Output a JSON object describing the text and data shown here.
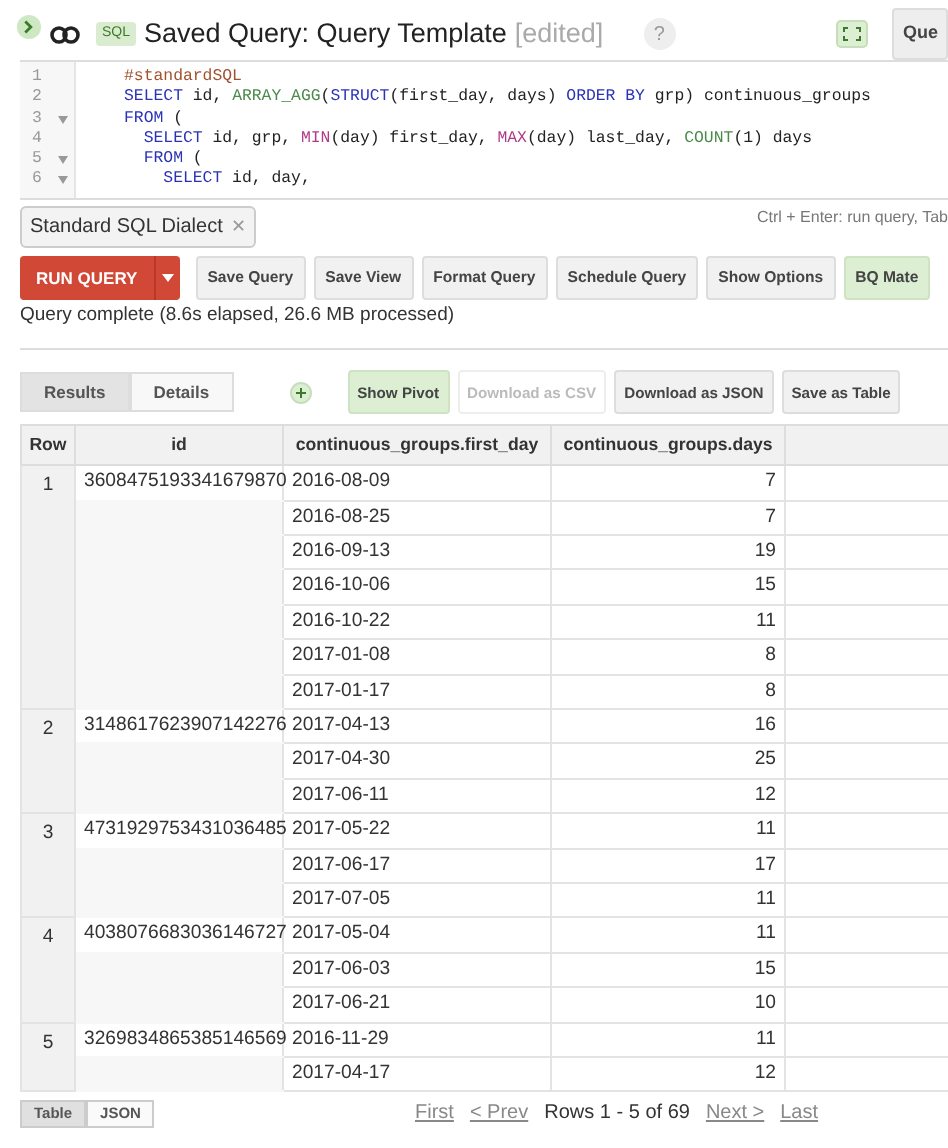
{
  "header": {
    "tag": "SQL",
    "title": "Saved Query: Query Template",
    "state": "[edited]",
    "help": "?",
    "cut_button": "Que"
  },
  "editor": {
    "lines": [
      {
        "number": "1",
        "fold": false,
        "tokens": [
          {
            "kind": "comment",
            "text": "#standardSQL"
          }
        ]
      },
      {
        "number": "2",
        "fold": false,
        "tokens": [
          {
            "kind": "keyword",
            "text": "SELECT"
          },
          {
            "kind": "plain",
            "text": " id, "
          },
          {
            "kind": "function",
            "text": "ARRAY_AGG"
          },
          {
            "kind": "plain",
            "text": "("
          },
          {
            "kind": "keyword",
            "text": "STRUCT"
          },
          {
            "kind": "plain",
            "text": "(first_day, days) "
          },
          {
            "kind": "keyword",
            "text": "ORDER BY"
          },
          {
            "kind": "plain",
            "text": " grp) continuous_groups"
          }
        ]
      },
      {
        "number": "3",
        "fold": true,
        "tokens": [
          {
            "kind": "keyword",
            "text": "FROM"
          },
          {
            "kind": "plain",
            "text": " ("
          }
        ]
      },
      {
        "number": "4",
        "fold": false,
        "tokens": [
          {
            "kind": "keyword",
            "text": "  SELECT"
          },
          {
            "kind": "plain",
            "text": " id, grp, "
          },
          {
            "kind": "builtin",
            "text": "MIN"
          },
          {
            "kind": "plain",
            "text": "(day) first_day, "
          },
          {
            "kind": "builtin",
            "text": "MAX"
          },
          {
            "kind": "plain",
            "text": "(day) last_day, "
          },
          {
            "kind": "function",
            "text": "COUNT"
          },
          {
            "kind": "plain",
            "text": "(1) days"
          }
        ]
      },
      {
        "number": "5",
        "fold": true,
        "tokens": [
          {
            "kind": "keyword",
            "text": "  FROM"
          },
          {
            "kind": "plain",
            "text": " ("
          }
        ]
      },
      {
        "number": "6",
        "fold": true,
        "tokens": [
          {
            "kind": "keyword",
            "text": "    SELECT"
          },
          {
            "kind": "plain",
            "text": " id, day,"
          }
        ]
      }
    ],
    "hint": "Ctrl + Enter: run query, Tab"
  },
  "dialect_chip": {
    "label": "Standard SQL Dialect",
    "close": "✕"
  },
  "toolbar": {
    "run": "RUN QUERY",
    "buttons": [
      {
        "label": "Save Query",
        "kind": "plain"
      },
      {
        "label": "Save View",
        "kind": "plain"
      },
      {
        "label": "Format Query",
        "kind": "plain"
      },
      {
        "label": "Schedule Query",
        "kind": "plain"
      },
      {
        "label": "Show Options",
        "kind": "plain"
      },
      {
        "label": "BQ Mate",
        "kind": "green"
      }
    ]
  },
  "status": "Query complete (8.6s elapsed, 26.6 MB processed)",
  "result_tabs": [
    {
      "label": "Results",
      "selected": true
    },
    {
      "label": "Details",
      "selected": false
    }
  ],
  "result_buttons": [
    {
      "label": "Show Pivot",
      "kind": "green"
    },
    {
      "label": "Download as CSV",
      "kind": "disabled"
    },
    {
      "label": "Download as JSON",
      "kind": "plain"
    },
    {
      "label": "Save as Table",
      "kind": "plain"
    }
  ],
  "table": {
    "columns": [
      "Row",
      "id",
      "continuous_groups.first_day",
      "continuous_groups.days"
    ],
    "rows": [
      {
        "row": "1",
        "id": "3608475193341679870",
        "groups": [
          {
            "first_day": "2016-08-09",
            "days": "7"
          },
          {
            "first_day": "2016-08-25",
            "days": "7"
          },
          {
            "first_day": "2016-09-13",
            "days": "19"
          },
          {
            "first_day": "2016-10-06",
            "days": "15"
          },
          {
            "first_day": "2016-10-22",
            "days": "11"
          },
          {
            "first_day": "2017-01-08",
            "days": "8"
          },
          {
            "first_day": "2017-01-17",
            "days": "8"
          }
        ]
      },
      {
        "row": "2",
        "id": "3148617623907142276",
        "groups": [
          {
            "first_day": "2017-04-13",
            "days": "16"
          },
          {
            "first_day": "2017-04-30",
            "days": "25"
          },
          {
            "first_day": "2017-06-11",
            "days": "12"
          }
        ]
      },
      {
        "row": "3",
        "id": "4731929753431036485",
        "groups": [
          {
            "first_day": "2017-05-22",
            "days": "11"
          },
          {
            "first_day": "2017-06-17",
            "days": "17"
          },
          {
            "first_day": "2017-07-05",
            "days": "11"
          }
        ]
      },
      {
        "row": "4",
        "id": "4038076683036146727",
        "groups": [
          {
            "first_day": "2017-05-04",
            "days": "11"
          },
          {
            "first_day": "2017-06-03",
            "days": "15"
          },
          {
            "first_day": "2017-06-21",
            "days": "10"
          }
        ]
      },
      {
        "row": "5",
        "id": "3269834865385146569",
        "groups": [
          {
            "first_day": "2016-11-29",
            "days": "11"
          },
          {
            "first_day": "2017-04-17",
            "days": "12"
          }
        ]
      }
    ]
  },
  "view_tabs": [
    {
      "label": "Table",
      "selected": true
    },
    {
      "label": "JSON",
      "selected": false
    }
  ],
  "pager": {
    "first": "First",
    "prev": "< Prev",
    "info": "Rows 1 - 5 of 69",
    "next": "Next >",
    "last": "Last"
  }
}
